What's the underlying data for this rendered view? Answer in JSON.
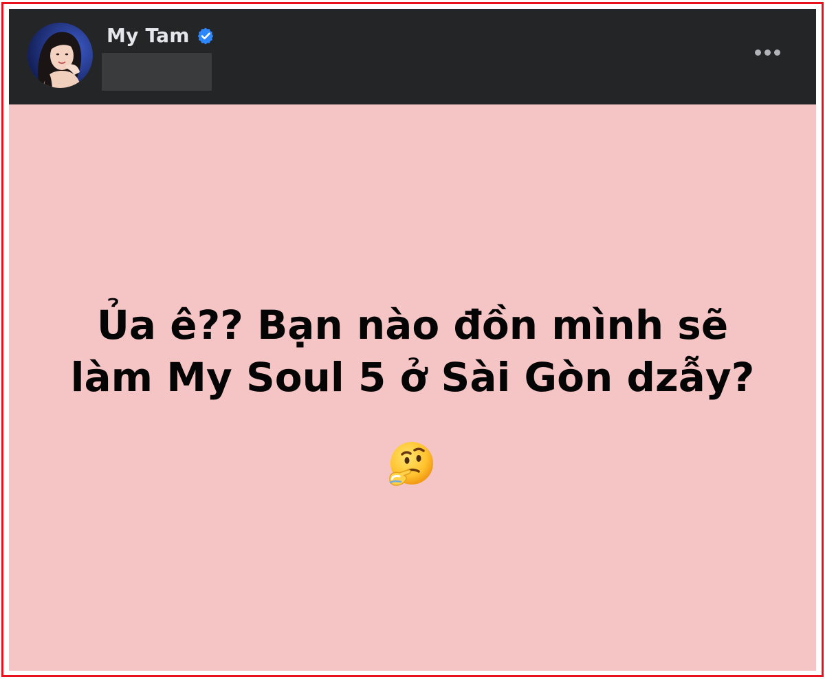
{
  "post": {
    "author": {
      "name": "My Tam",
      "verified": true
    },
    "text_lines": [
      "Ủa ê?? Bạn nào đồn mình sẽ",
      "làm My Soul 5 ở Sài Gòn dzẫy?"
    ],
    "emoji": "thinking-face",
    "background_color": "#f5c4c4",
    "header_color": "#242526"
  },
  "highlight_border_color": "#e8121c",
  "icons": {
    "verified": "verified-badge-icon",
    "more": "more-options-icon"
  }
}
